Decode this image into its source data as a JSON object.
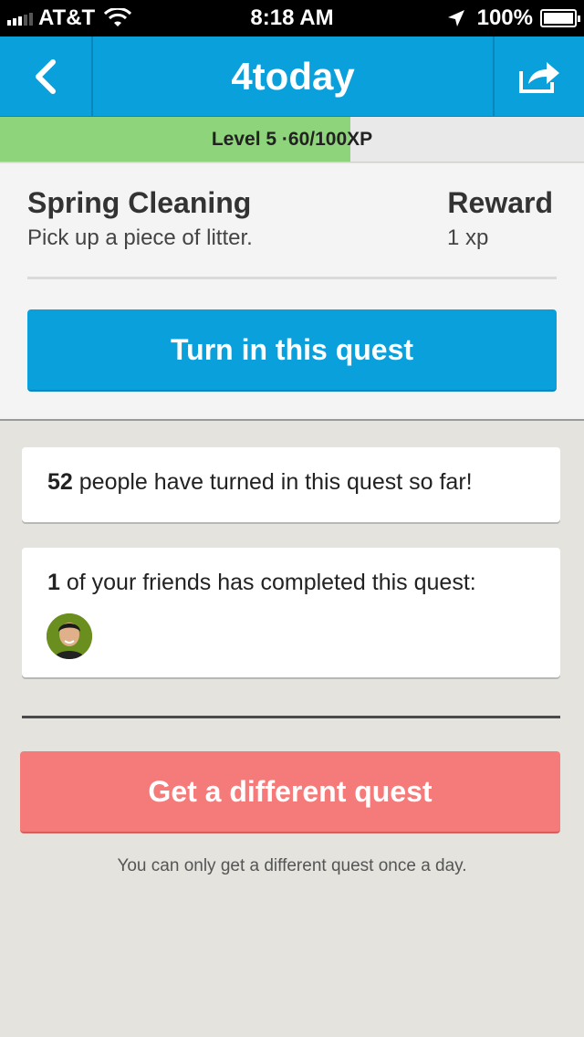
{
  "status_bar": {
    "carrier": "AT&T",
    "time": "8:18 AM",
    "battery": "100%"
  },
  "nav": {
    "title": "4today",
    "back_icon": "chevron-left-icon",
    "share_icon": "share-icon"
  },
  "xp": {
    "label_prefix": "Level 5 · ",
    "label_value": "60/100",
    "label_suffix": " XP",
    "progress": 0.6
  },
  "quest": {
    "title": "Spring Cleaning",
    "description": "Pick up a piece of litter.",
    "reward_label": "Reward",
    "reward_value": "1 xp",
    "turn_in_label": "Turn in this quest"
  },
  "stats": {
    "people_count": "52",
    "people_text": " people have turned in this quest so far!",
    "friends_count": "1",
    "friends_text": " of your friends has completed this quest:"
  },
  "actions": {
    "different_quest_label": "Get a different quest",
    "note": "You can only get a different quest once a day."
  },
  "colors": {
    "accent": "#0aa0dc",
    "xp_fill": "#8ed47b",
    "danger": "#f57b7a",
    "background": "#e4e3dd"
  }
}
